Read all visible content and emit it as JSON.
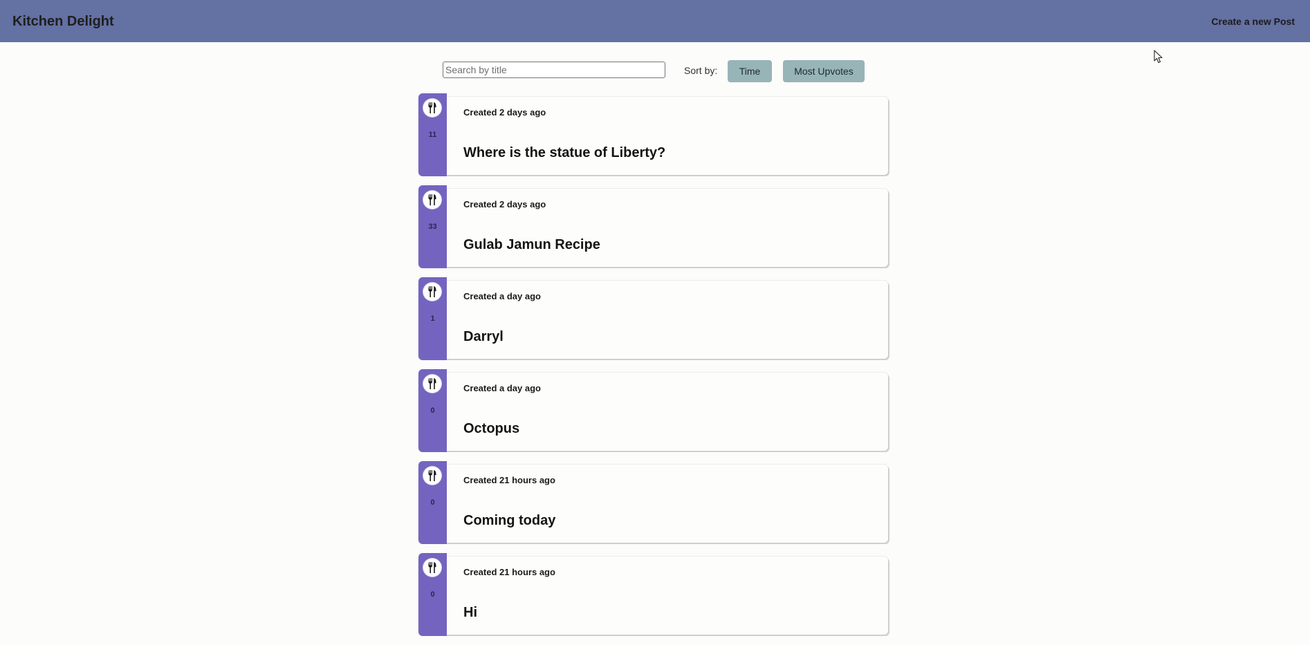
{
  "header": {
    "brand": "Kitchen Delight",
    "create_link": "Create a new Post"
  },
  "controls": {
    "search_placeholder": "Search by title",
    "search_value": "",
    "sort_label": "Sort by:",
    "sort_time": "Time",
    "sort_upvotes": "Most Upvotes"
  },
  "colors": {
    "header_bg": "#6371a3",
    "vote_strip": "#7464bf",
    "sort_button": "#97b4b7",
    "page_bg": "#fcfcfb"
  },
  "icons": {
    "vote": "fork-knife-icon",
    "cursor": "mouse-pointer-icon"
  },
  "posts": [
    {
      "votes": "11",
      "meta": "Created 2 days ago",
      "title": "Where is the statue of Liberty?"
    },
    {
      "votes": "33",
      "meta": "Created 2 days ago",
      "title": "Gulab Jamun Recipe"
    },
    {
      "votes": "1",
      "meta": "Created a day ago",
      "title": "Darryl"
    },
    {
      "votes": "0",
      "meta": "Created a day ago",
      "title": "Octopus"
    },
    {
      "votes": "0",
      "meta": "Created 21 hours ago",
      "title": "Coming today"
    },
    {
      "votes": "0",
      "meta": "Created 21 hours ago",
      "title": "Hi"
    }
  ]
}
